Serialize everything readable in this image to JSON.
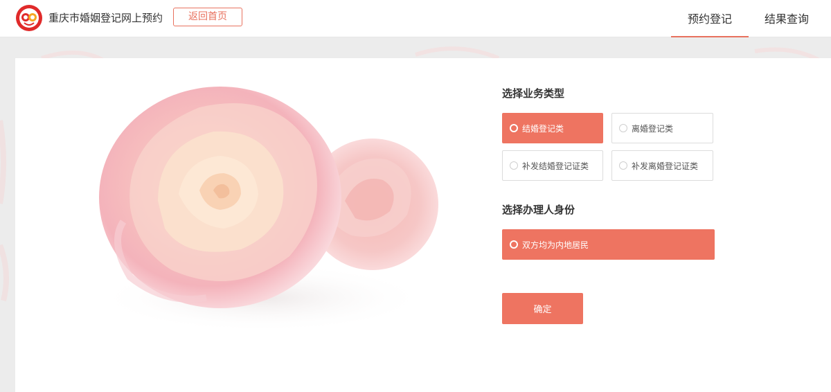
{
  "header": {
    "site_title": "重庆市婚姻登记网上预约",
    "back_label": "返回首页",
    "nav": [
      {
        "label": "预约登记",
        "active": true
      },
      {
        "label": "结果查询",
        "active": false
      }
    ]
  },
  "form": {
    "business_type_title": "选择业务类型",
    "business_types": [
      {
        "label": "结婚登记类",
        "selected": true
      },
      {
        "label": "离婚登记类",
        "selected": false
      },
      {
        "label": "补发结婚登记证类",
        "selected": false
      },
      {
        "label": "补发离婚登记证类",
        "selected": false
      }
    ],
    "identity_title": "选择办理人身份",
    "identities": [
      {
        "label": "双方均为内地居民",
        "selected": true
      }
    ],
    "confirm_label": "确定"
  },
  "colors": {
    "accent": "#ee7461",
    "header_bg": "#ffffff",
    "page_bg": "#ececec"
  },
  "icons": {
    "logo": "marriage-registration-logo",
    "radio": "radio-circle-icon"
  }
}
